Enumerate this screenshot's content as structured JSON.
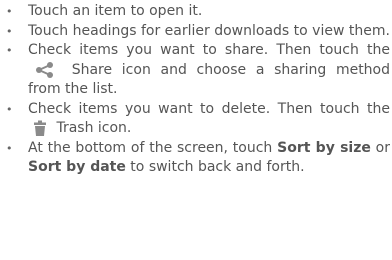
{
  "bullet_glyph": "•",
  "items": [
    {
      "text": "Touch an item to open it."
    },
    {
      "text": "Touch headings for earlier downloads to view them."
    },
    {
      "before": "Check items you want to share. Then touch the",
      "after": "Share icon and choose a sharing method from the list.",
      "icon": "share-icon"
    },
    {
      "before": "Check items you want to delete. Then touch the",
      "after": "Trash icon.",
      "icon": "trash-icon"
    },
    {
      "t1": "At the bottom of the screen, touch ",
      "b1": "Sort by size",
      "t2": " or ",
      "b2": "Sort by date",
      "t3": " to switch back and forth."
    }
  ],
  "colors": {
    "text": "#555555",
    "icon": "#8a8a8a"
  }
}
